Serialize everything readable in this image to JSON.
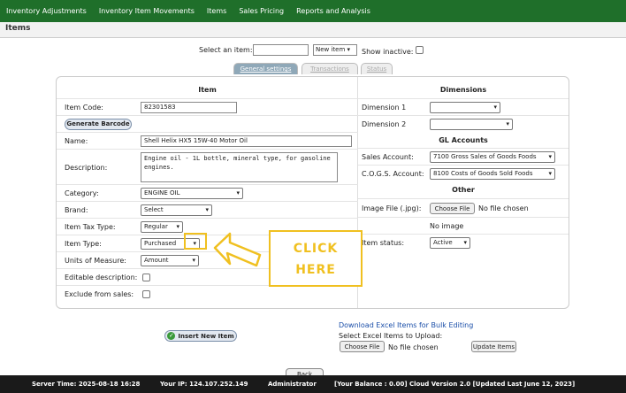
{
  "nav": [
    "Inventory Adjustments",
    "Inventory Item Movements",
    "Items",
    "Sales Pricing",
    "Reports and Analysis"
  ],
  "page_title": "Items",
  "selector": {
    "label": "Select an item:",
    "new_item": "New item",
    "show_inactive": "Show inactive:"
  },
  "tabs": [
    "General settings",
    "Transactions",
    "Status"
  ],
  "item": {
    "heading": "Item",
    "code_label": "Item Code:",
    "code_value": "82301583",
    "gen_barcode": "Generate Barcode",
    "name_label": "Name:",
    "name_value": "Shell Helix HX5 15W-40 Motor Oil",
    "desc_label": "Description:",
    "desc_value": "Engine oil - 1L bottle, mineral type, for gasoline engines.",
    "category_label": "Category:",
    "category_value": "ENGINE OIL",
    "brand_label": "Brand:",
    "brand_value": "Select",
    "tax_label": "Item Tax Type:",
    "tax_value": "Regular",
    "type_label": "Item Type:",
    "type_value": "Purchased",
    "uom_label": "Units of Measure:",
    "uom_value": "Amount",
    "editable_label": "Editable description:",
    "exclude_label": "Exclude from sales:"
  },
  "dims": {
    "heading": "Dimensions",
    "dim1_label": "Dimension 1",
    "dim2_label": "Dimension 2",
    "gl_heading": "GL Accounts",
    "sales_label": "Sales Account:",
    "sales_value": "7100    Gross Sales of Goods Foods",
    "cogs_label": "C.O.G.S. Account:",
    "cogs_value": "8100    Costs of Goods Sold Foods",
    "other_heading": "Other",
    "image_label": "Image File (.jpg):",
    "choose_file": "Choose File",
    "no_file": "No file chosen",
    "no_image": "No image",
    "status_label": "Item status:",
    "status_value": "Active"
  },
  "callout": {
    "line1": "CLICK",
    "line2": "HERE"
  },
  "insert_btn": "Insert New Item",
  "excel": {
    "download": "Download Excel Items for Bulk Editing",
    "select": "Select Excel Items to Upload:",
    "choose": "Choose File",
    "no_file": "No file chosen",
    "update": "Update Items"
  },
  "back": "Back",
  "footer": {
    "server_time": "Server Time: 2025-08-18 16:28",
    "ip": "Your IP: 124.107.252.149",
    "user": "Administrator",
    "balance": "[Your Balance : 0.00] Cloud Version 2.0 [Updated Last June 12, 2023]"
  },
  "colors": {
    "nav": "#1f6f2a",
    "callout": "#f0c020"
  }
}
